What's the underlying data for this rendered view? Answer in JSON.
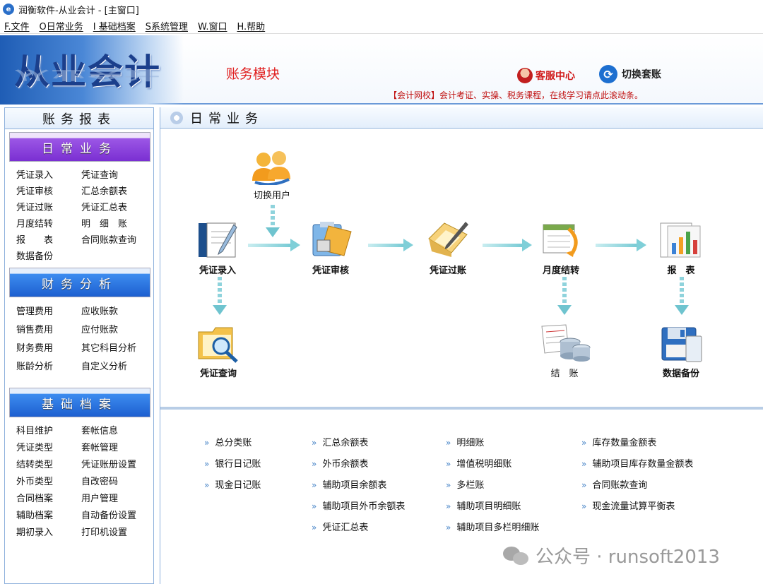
{
  "window": {
    "title": "润衡软件-从业会计 - [主窗口]",
    "app_icon": "app-logo-icon"
  },
  "menu": [
    {
      "label": "F.文件"
    },
    {
      "label": "O日常业务"
    },
    {
      "label": "I 基础档案"
    },
    {
      "label": "S系统管理"
    },
    {
      "label": "W.窗口"
    },
    {
      "label": "H.帮助"
    }
  ],
  "banner": {
    "logo": "从业会计",
    "module": "账务模块",
    "service": "客服中心",
    "switch_account": "切换套账",
    "notice": "【会计网校】会计考证、实操、税务课程，在线学习请点此滚动条。"
  },
  "sidebar": {
    "title": "账务报表",
    "sections": [
      {
        "title": "日常业务",
        "items": [
          "凭证录入",
          "凭证查询",
          "凭证审核",
          "汇总余额表",
          "凭证过账",
          "凭证汇总表",
          "月度结转",
          "明　细　账",
          "报　　表",
          "合同账款查询",
          "数据备份"
        ]
      },
      {
        "title": "财务分析",
        "items": [
          "管理费用",
          "应收账款",
          "销售费用",
          "应付账款",
          "财务费用",
          "其它科目分析",
          "账龄分析",
          "自定义分析"
        ]
      },
      {
        "title": "基础档案",
        "items": [
          "科目维护",
          "套帐信息",
          "凭证类型",
          "套帐管理",
          "结转类型",
          "凭证账册设置",
          "外币类型",
          "自改密码",
          "合同档案",
          "用户管理",
          "辅助档案",
          "自动备份设置",
          "期初录入",
          "打印机设置"
        ]
      }
    ]
  },
  "main": {
    "title": "日常业务",
    "flow": {
      "switch_user": "切换用户",
      "entry": "凭证录入",
      "audit": "凭证审核",
      "post": "凭证过账",
      "close": "月度结转",
      "report": "报　表",
      "query": "凭证查询",
      "settle": "结　账",
      "backup": "数据备份"
    },
    "links": [
      [
        "总分类账",
        "银行日记账",
        "现金日记账"
      ],
      [
        "汇总余额表",
        "外币余额表",
        "辅助项目余额表",
        "辅助项目外币余额表",
        "凭证汇总表"
      ],
      [
        "明细账",
        "增值税明细账",
        "多栏账",
        "辅助项目明细账",
        "辅助项目多栏明细账"
      ],
      [
        "库存数量金额表",
        "辅助项目库存数量金额表",
        "合同账款查询",
        "现金流量试算平衡表"
      ]
    ]
  },
  "watermark": "公众号 · runsoft2013"
}
